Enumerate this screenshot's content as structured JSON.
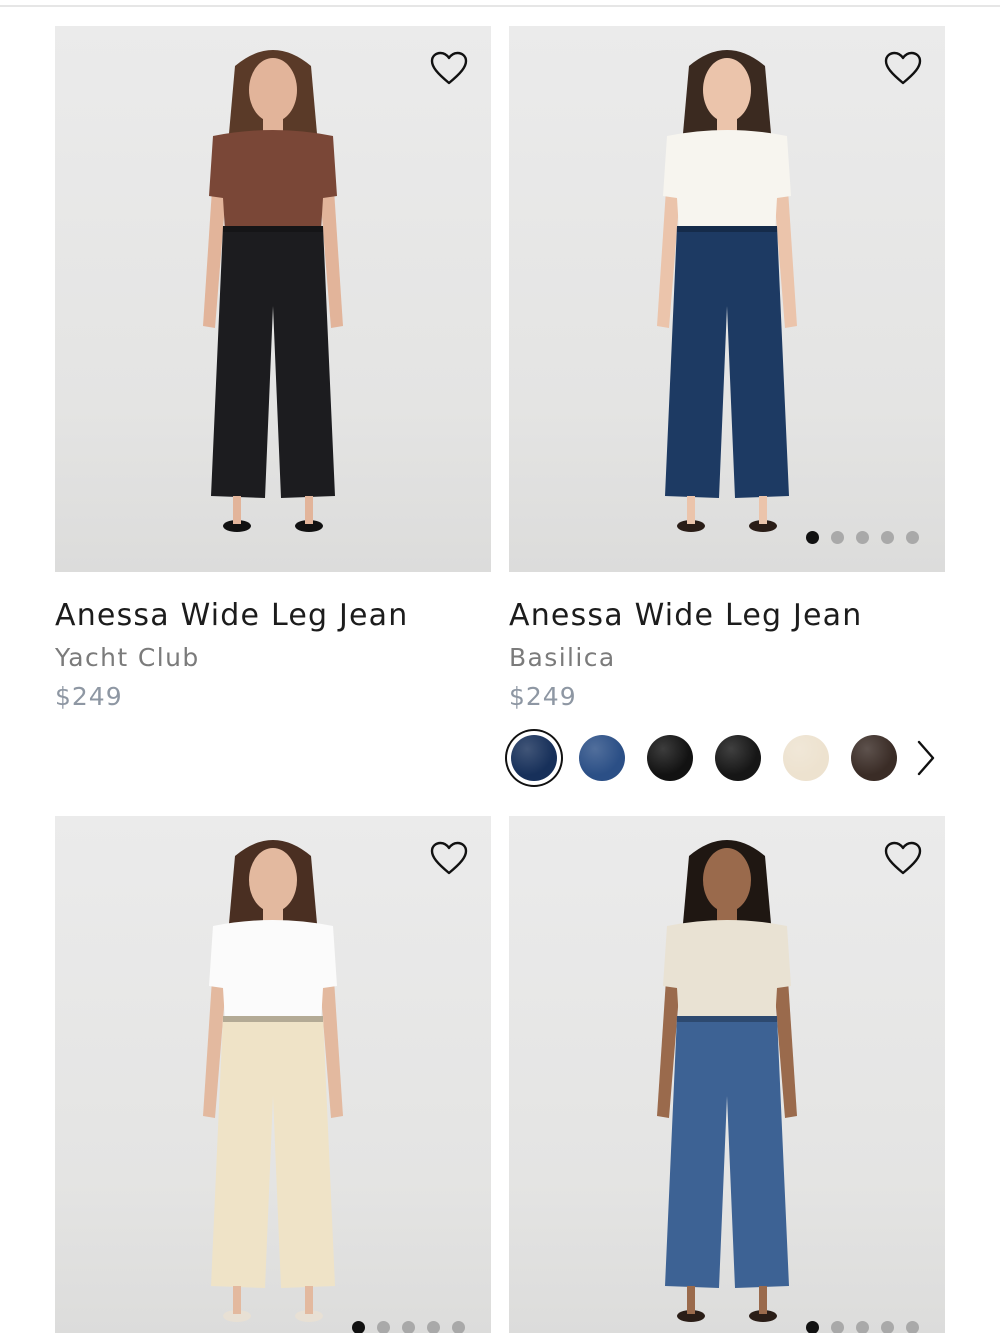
{
  "products": [
    {
      "name": "Anessa Wide Leg Jean",
      "color": "Yacht Club",
      "price": "$249",
      "wishlist_icon": "heart-outline-icon",
      "image": {
        "hair": "#5a3a28",
        "skin": "#e2b49a",
        "top": "#7a4737",
        "pants": "#1c1c1f",
        "shoes": "#111111"
      }
    },
    {
      "name": "Anessa Wide Leg Jean",
      "color": "Basilica",
      "price": "$249",
      "wishlist_icon": "heart-outline-icon",
      "carousel_dots": 5,
      "carousel_active": 0,
      "swatches": [
        "#17305a",
        "#2b4f86",
        "#121212",
        "#161616",
        "#ede2cf",
        "#3a2c26"
      ],
      "swatch_selected": 0,
      "swatch_next_icon": "chevron-right-icon",
      "image": {
        "hair": "#3b2a20",
        "skin": "#ebc4ab",
        "top": "#f7f5ef",
        "pants": "#1d3a63",
        "shoes": "#2a1d17"
      }
    },
    {
      "name": "",
      "wishlist_icon": "heart-outline-icon",
      "carousel_dots": 5,
      "carousel_active": 0,
      "image": {
        "hair": "#4a2f22",
        "skin": "#e3b99f",
        "top": "#fbfbfb",
        "pants": "#efe3c7",
        "shoes": "#e8e0d4"
      }
    },
    {
      "name": "",
      "wishlist_icon": "heart-outline-icon",
      "carousel_dots": 5,
      "carousel_active": 0,
      "image": {
        "hair": "#1f1712",
        "skin": "#9a6a4c",
        "top": "#e9e2d3",
        "pants": "#3d6294",
        "shoes": "#2a1d17"
      }
    }
  ]
}
